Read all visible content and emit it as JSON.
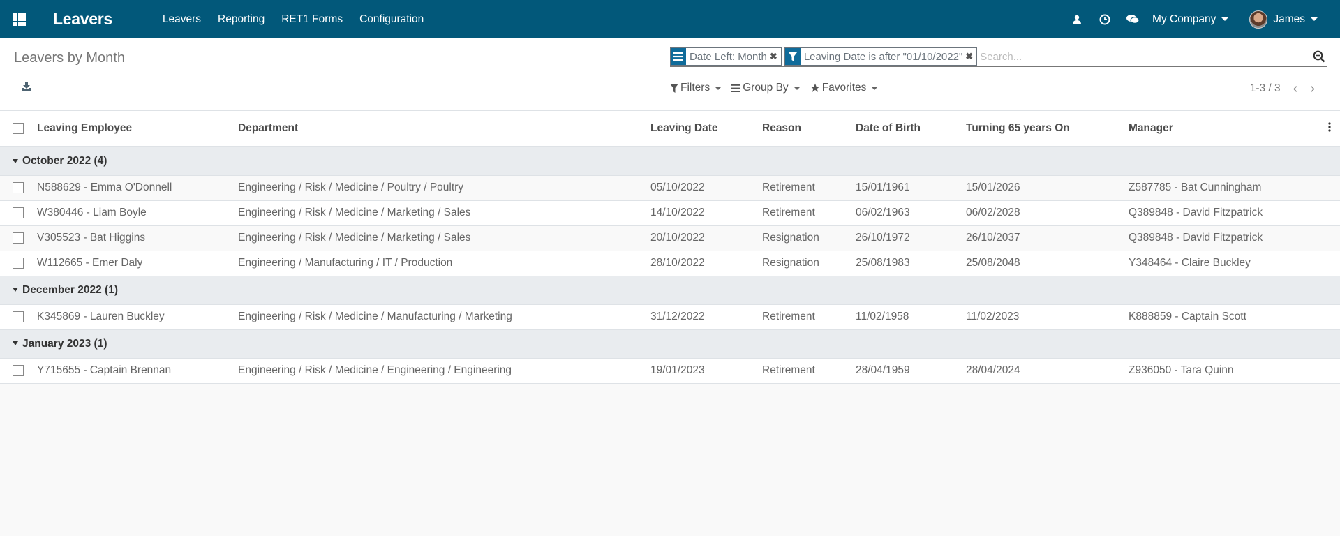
{
  "navbar": {
    "app_name": "Leavers",
    "menu": [
      "Leavers",
      "Reporting",
      "RET1 Forms",
      "Configuration"
    ],
    "company": "My Company",
    "user": "James",
    "icons": [
      "apps-grid-icon",
      "user-icon",
      "clock-icon",
      "chat-icon"
    ]
  },
  "control_panel": {
    "title": "Leavers by Month",
    "facets": [
      {
        "type": "group-by",
        "label": "Date Left: Month"
      },
      {
        "type": "filter",
        "label": "Leaving Date is after \"01/10/2022\""
      }
    ],
    "search_placeholder": "Search...",
    "filters_label": "Filters",
    "groupby_label": "Group By",
    "favorites_label": "Favorites",
    "pager": "1-3 / 3"
  },
  "table": {
    "columns": [
      "Leaving Employee",
      "Department",
      "Leaving Date",
      "Reason",
      "Date of Birth",
      "Turning 65 years On",
      "Manager"
    ],
    "groups": [
      {
        "label": "October 2022 (4)",
        "rows": [
          [
            "N588629 - Emma O'Donnell",
            "Engineering / Risk / Medicine / Poultry / Poultry",
            "05/10/2022",
            "Retirement",
            "15/01/1961",
            "15/01/2026",
            "Z587785 - Bat Cunningham"
          ],
          [
            "W380446 - Liam Boyle",
            "Engineering / Risk / Medicine / Marketing / Sales",
            "14/10/2022",
            "Retirement",
            "06/02/1963",
            "06/02/2028",
            "Q389848 - David Fitzpatrick"
          ],
          [
            "V305523 - Bat Higgins",
            "Engineering / Risk / Medicine / Marketing / Sales",
            "20/10/2022",
            "Resignation",
            "26/10/1972",
            "26/10/2037",
            "Q389848 - David Fitzpatrick"
          ],
          [
            "W112665 - Emer Daly",
            "Engineering / Manufacturing / IT / Production",
            "28/10/2022",
            "Resignation",
            "25/08/1983",
            "25/08/2048",
            "Y348464 - Claire Buckley"
          ]
        ]
      },
      {
        "label": "December 2022 (1)",
        "rows": [
          [
            "K345869 - Lauren Buckley",
            "Engineering / Risk / Medicine / Manufacturing / Marketing",
            "31/12/2022",
            "Retirement",
            "11/02/1958",
            "11/02/2023",
            "K888859 - Captain Scott"
          ]
        ]
      },
      {
        "label": "January 2023 (1)",
        "rows": [
          [
            "Y715655 - Captain Brennan",
            "Engineering / Risk / Medicine / Engineering / Engineering",
            "19/01/2023",
            "Retirement",
            "28/04/1959",
            "28/04/2024",
            "Z936050 - Tara Quinn"
          ]
        ]
      }
    ]
  },
  "colors": {
    "navbar": "#02587a",
    "facet_icon": "#0f6b9a",
    "group_row": "#e9ecef"
  }
}
